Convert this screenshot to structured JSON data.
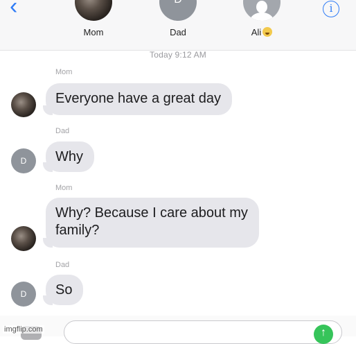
{
  "header": {
    "back_icon": "chevron-left-icon",
    "back_glyph": "‹",
    "contacts": [
      {
        "name": "Mom"
      },
      {
        "name": "Dad",
        "initial": "D"
      },
      {
        "name": "Ali"
      }
    ],
    "info_glyph": "i"
  },
  "timestamp": "Today 9:12 AM",
  "messages": [
    {
      "sender": "Mom",
      "text": "Everyone have a great day"
    },
    {
      "sender": "Dad",
      "avatar_initial": "D",
      "text": "Why"
    },
    {
      "sender": "Mom",
      "text_line1": "Why? Because I care about my",
      "text_line2": "family?"
    },
    {
      "sender": "Dad",
      "avatar_initial": "D",
      "text": "So"
    }
  ],
  "composer": {
    "placeholder": "",
    "send_glyph": "↑"
  },
  "watermark": "imgflip.com",
  "colors": {
    "accent": "#2f7cf6",
    "bubble_received": "#e6e6eb",
    "send_green": "#36c45a"
  }
}
